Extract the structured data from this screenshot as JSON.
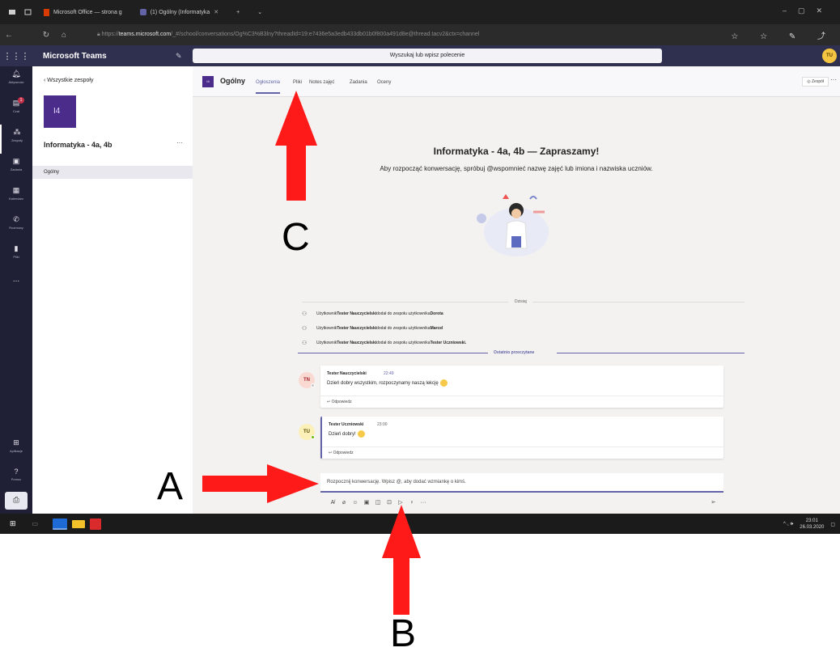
{
  "browser": {
    "tabs": [
      {
        "label": "Microsoft Office — strona g"
      },
      {
        "label": "(1) Ogólny (Informatyka"
      }
    ],
    "new_tab": "+",
    "url_prefix": "https://",
    "url_host": "teams.microsoft.com",
    "url_rest": "/_#/school/conversations/Og%C3%B3lny?threadId=19:e7436e5a3edb433db01b0f800a491d8e@thread.tacv2&ctx=channel"
  },
  "teams": {
    "app_title": "Microsoft Teams",
    "search_placeholder": "Wyszukaj lub wpisz polecenie",
    "user_initials": "TU"
  },
  "rail": {
    "items": [
      {
        "label": "Aktywność",
        "icon": "bell-icon"
      },
      {
        "label": "Czat",
        "icon": "chat-icon",
        "badge": "1"
      },
      {
        "label": "Zespoły",
        "icon": "teams-icon"
      },
      {
        "label": "Zadania",
        "icon": "assignments-icon"
      },
      {
        "label": "Kalendarz",
        "icon": "calendar-icon"
      },
      {
        "label": "Rozmowy",
        "icon": "phone-icon"
      },
      {
        "label": "Pliki",
        "icon": "files-icon"
      }
    ],
    "more": "...",
    "apps_label": "Aplikacje",
    "help_label": "Pomoc"
  },
  "panel": {
    "back_label": "Wszystkie zespoły",
    "team_tile": "I4",
    "team_name": "Informatyka - 4a, 4b",
    "team_more": "···",
    "channel": "Ogólny"
  },
  "header": {
    "avatar": "I4",
    "title": "Ogólny",
    "tabs": [
      "Ogłoszenia",
      "Pliki",
      "Notes zajęć",
      "Zadania",
      "Oceny"
    ],
    "team_button": "◎ Zespół",
    "more": "···"
  },
  "welcome": {
    "title": "Informatyka - 4a, 4b — Zapraszamy!",
    "subtitle": "Aby rozpocząć konwersację, spróbuj @wspomnieć nazwę zajęć lub imiona i nazwiska uczniów."
  },
  "feed": {
    "today": "Dzisiaj",
    "system": [
      {
        "pre": "Użytkownik ",
        "actor": "Tester Nauczycielski",
        "mid": " dodał do zespołu użytkownika ",
        "target": "Dorota"
      },
      {
        "pre": "Użytkownik ",
        "actor": "Tester Nauczycielski",
        "mid": " dodał do zespołu użytkownika ",
        "target": "Marcel"
      },
      {
        "pre": "Użytkownik ",
        "actor": "Tester Nauczycielski",
        "mid": " dodał do zespołu użytkownika ",
        "target": "Tester Uczniowski."
      }
    ],
    "last_read": "Ostatnio przeczytane",
    "messages": [
      {
        "initials": "TN",
        "author": "Tester Nauczycielski",
        "time": "22:49",
        "text": "Dzień dobry wszystkim, rozpoczynamy naszą lekcję",
        "reply": "↩ Odpowiedz"
      },
      {
        "initials": "TU",
        "author": "Tester Uczniowski",
        "time": "23:00",
        "text": "Dzień dobry!",
        "reply": "↩ Odpowiedz"
      }
    ]
  },
  "compose": {
    "placeholder": "Rozpocznij konwersację. Wpisz @, aby dodać wzmiankę o kimś.",
    "toolbar_more": "···"
  },
  "taskbar": {
    "time": "23:01",
    "date": "26.03.2020"
  },
  "annotations": {
    "A": "A",
    "B": "B",
    "C": "C"
  }
}
